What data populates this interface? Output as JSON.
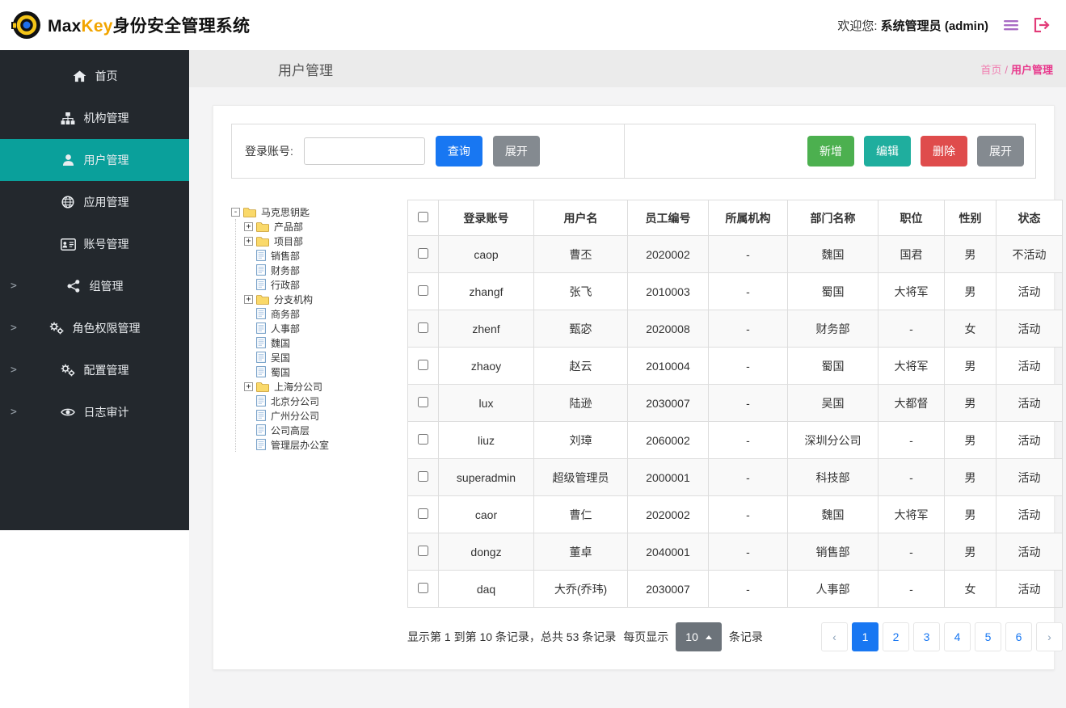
{
  "header": {
    "brand_max": "Max",
    "brand_key": "Key",
    "brand_suffix": "身份安全管理系统",
    "welcome_prefix": "欢迎您:",
    "welcome_user": "系统管理员 (admin)"
  },
  "sidebar": {
    "items": [
      {
        "id": "home",
        "label": "首页",
        "icon": "home",
        "active": false,
        "expandable": false
      },
      {
        "id": "org",
        "label": "机构管理",
        "icon": "sitemap",
        "active": false,
        "expandable": false
      },
      {
        "id": "user",
        "label": "用户管理",
        "icon": "user",
        "active": true,
        "expandable": false
      },
      {
        "id": "app",
        "label": "应用管理",
        "icon": "globe",
        "active": false,
        "expandable": false
      },
      {
        "id": "account",
        "label": "账号管理",
        "icon": "idcard",
        "active": false,
        "expandable": false
      },
      {
        "id": "group",
        "label": "组管理",
        "icon": "share",
        "active": false,
        "expandable": true
      },
      {
        "id": "role",
        "label": "角色权限管理",
        "icon": "gears",
        "active": false,
        "expandable": true
      },
      {
        "id": "config",
        "label": "配置管理",
        "icon": "gears",
        "active": false,
        "expandable": true
      },
      {
        "id": "audit",
        "label": "日志审计",
        "icon": "eye",
        "active": false,
        "expandable": true
      }
    ]
  },
  "page": {
    "title": "用户管理",
    "breadcrumb": [
      "首页",
      "用户管理"
    ]
  },
  "toolbar": {
    "search_label": "登录账号:",
    "search_value": "",
    "query": "查询",
    "expand_left": "展开",
    "add": "新增",
    "edit": "编辑",
    "delete": "删除",
    "expand_right": "展开"
  },
  "tree": {
    "root": "马克思钥匙",
    "nodes": [
      {
        "label": "产品部",
        "icon": "folder",
        "expander": "plus"
      },
      {
        "label": "项目部",
        "icon": "folder",
        "expander": "plus"
      },
      {
        "label": "销售部",
        "icon": "file"
      },
      {
        "label": "财务部",
        "icon": "file"
      },
      {
        "label": "行政部",
        "icon": "file"
      },
      {
        "label": "分支机构",
        "icon": "folder",
        "expander": "plus"
      },
      {
        "label": "商务部",
        "icon": "file"
      },
      {
        "label": "人事部",
        "icon": "file"
      },
      {
        "label": "魏国",
        "icon": "file"
      },
      {
        "label": "吴国",
        "icon": "file"
      },
      {
        "label": "蜀国",
        "icon": "file"
      },
      {
        "label": "上海分公司",
        "icon": "folder",
        "expander": "plus"
      },
      {
        "label": "北京分公司",
        "icon": "file"
      },
      {
        "label": "广州分公司",
        "icon": "file"
      },
      {
        "label": "公司高层",
        "icon": "file"
      },
      {
        "label": "管理层办公室",
        "icon": "file"
      }
    ]
  },
  "table": {
    "headers": [
      "登录账号",
      "用户名",
      "员工编号",
      "所属机构",
      "部门名称",
      "职位",
      "性别",
      "状态"
    ],
    "rows": [
      [
        "caop",
        "曹丕",
        "2020002",
        "-",
        "魏国",
        "国君",
        "男",
        "不活动"
      ],
      [
        "zhangf",
        "张飞",
        "2010003",
        "-",
        "蜀国",
        "大将军",
        "男",
        "活动"
      ],
      [
        "zhenf",
        "甄宓",
        "2020008",
        "-",
        "财务部",
        "-",
        "女",
        "活动"
      ],
      [
        "zhaoy",
        "赵云",
        "2010004",
        "-",
        "蜀国",
        "大将军",
        "男",
        "活动"
      ],
      [
        "lux",
        "陆逊",
        "2030007",
        "-",
        "吴国",
        "大都督",
        "男",
        "活动"
      ],
      [
        "liuz",
        "刘璋",
        "2060002",
        "-",
        "深圳分公司",
        "-",
        "男",
        "活动"
      ],
      [
        "superadmin",
        "超级管理员",
        "2000001",
        "-",
        "科技部",
        "-",
        "男",
        "活动"
      ],
      [
        "caor",
        "曹仁",
        "2020002",
        "-",
        "魏国",
        "大将军",
        "男",
        "活动"
      ],
      [
        "dongz",
        "董卓",
        "2040001",
        "-",
        "销售部",
        "-",
        "男",
        "活动"
      ],
      [
        "daq",
        "大乔(乔玮)",
        "2030007",
        "-",
        "人事部",
        "-",
        "女",
        "活动"
      ]
    ]
  },
  "pagination": {
    "summary": "显示第 1 到第 10 条记录，总共 53 条记录",
    "per_page_label": "每页显示",
    "page_size": "10",
    "records_label": "条记录",
    "prev": "‹",
    "next": "›",
    "pages": [
      "1",
      "2",
      "3",
      "4",
      "5",
      "6"
    ],
    "active_page": "1"
  },
  "colors": {
    "sidebar_bg": "#23282d",
    "active_menu_teal": "#0aa09b",
    "primary_blue": "#1877f2",
    "add_green": "#4cb04f",
    "edit_teal": "#1fae9e",
    "delete_red": "#df4c4c",
    "expand_gray": "#848a90",
    "breadcrumb_pink": "#e8388c",
    "brand_key_orange": "#f2a500"
  }
}
